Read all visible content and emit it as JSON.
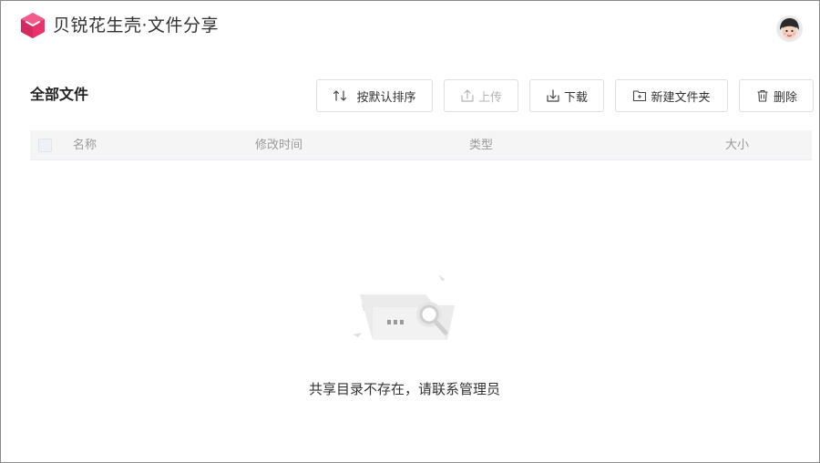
{
  "app": {
    "brand_title": "贝锐花生壳·文件分享",
    "brand_color": "#e8336d"
  },
  "header": {
    "avatar_icon": "user-avatar-icon"
  },
  "toolbar": {
    "title": "全部文件",
    "sort_label": "按默认排序",
    "upload_label": "上传",
    "download_label": "下载",
    "new_folder_label": "新建文件夹",
    "delete_label": "删除"
  },
  "table": {
    "columns": [
      "名称",
      "修改时间",
      "类型",
      "大小"
    ],
    "rows": []
  },
  "empty_state": {
    "message": "共享目录不存在，请联系管理员"
  }
}
